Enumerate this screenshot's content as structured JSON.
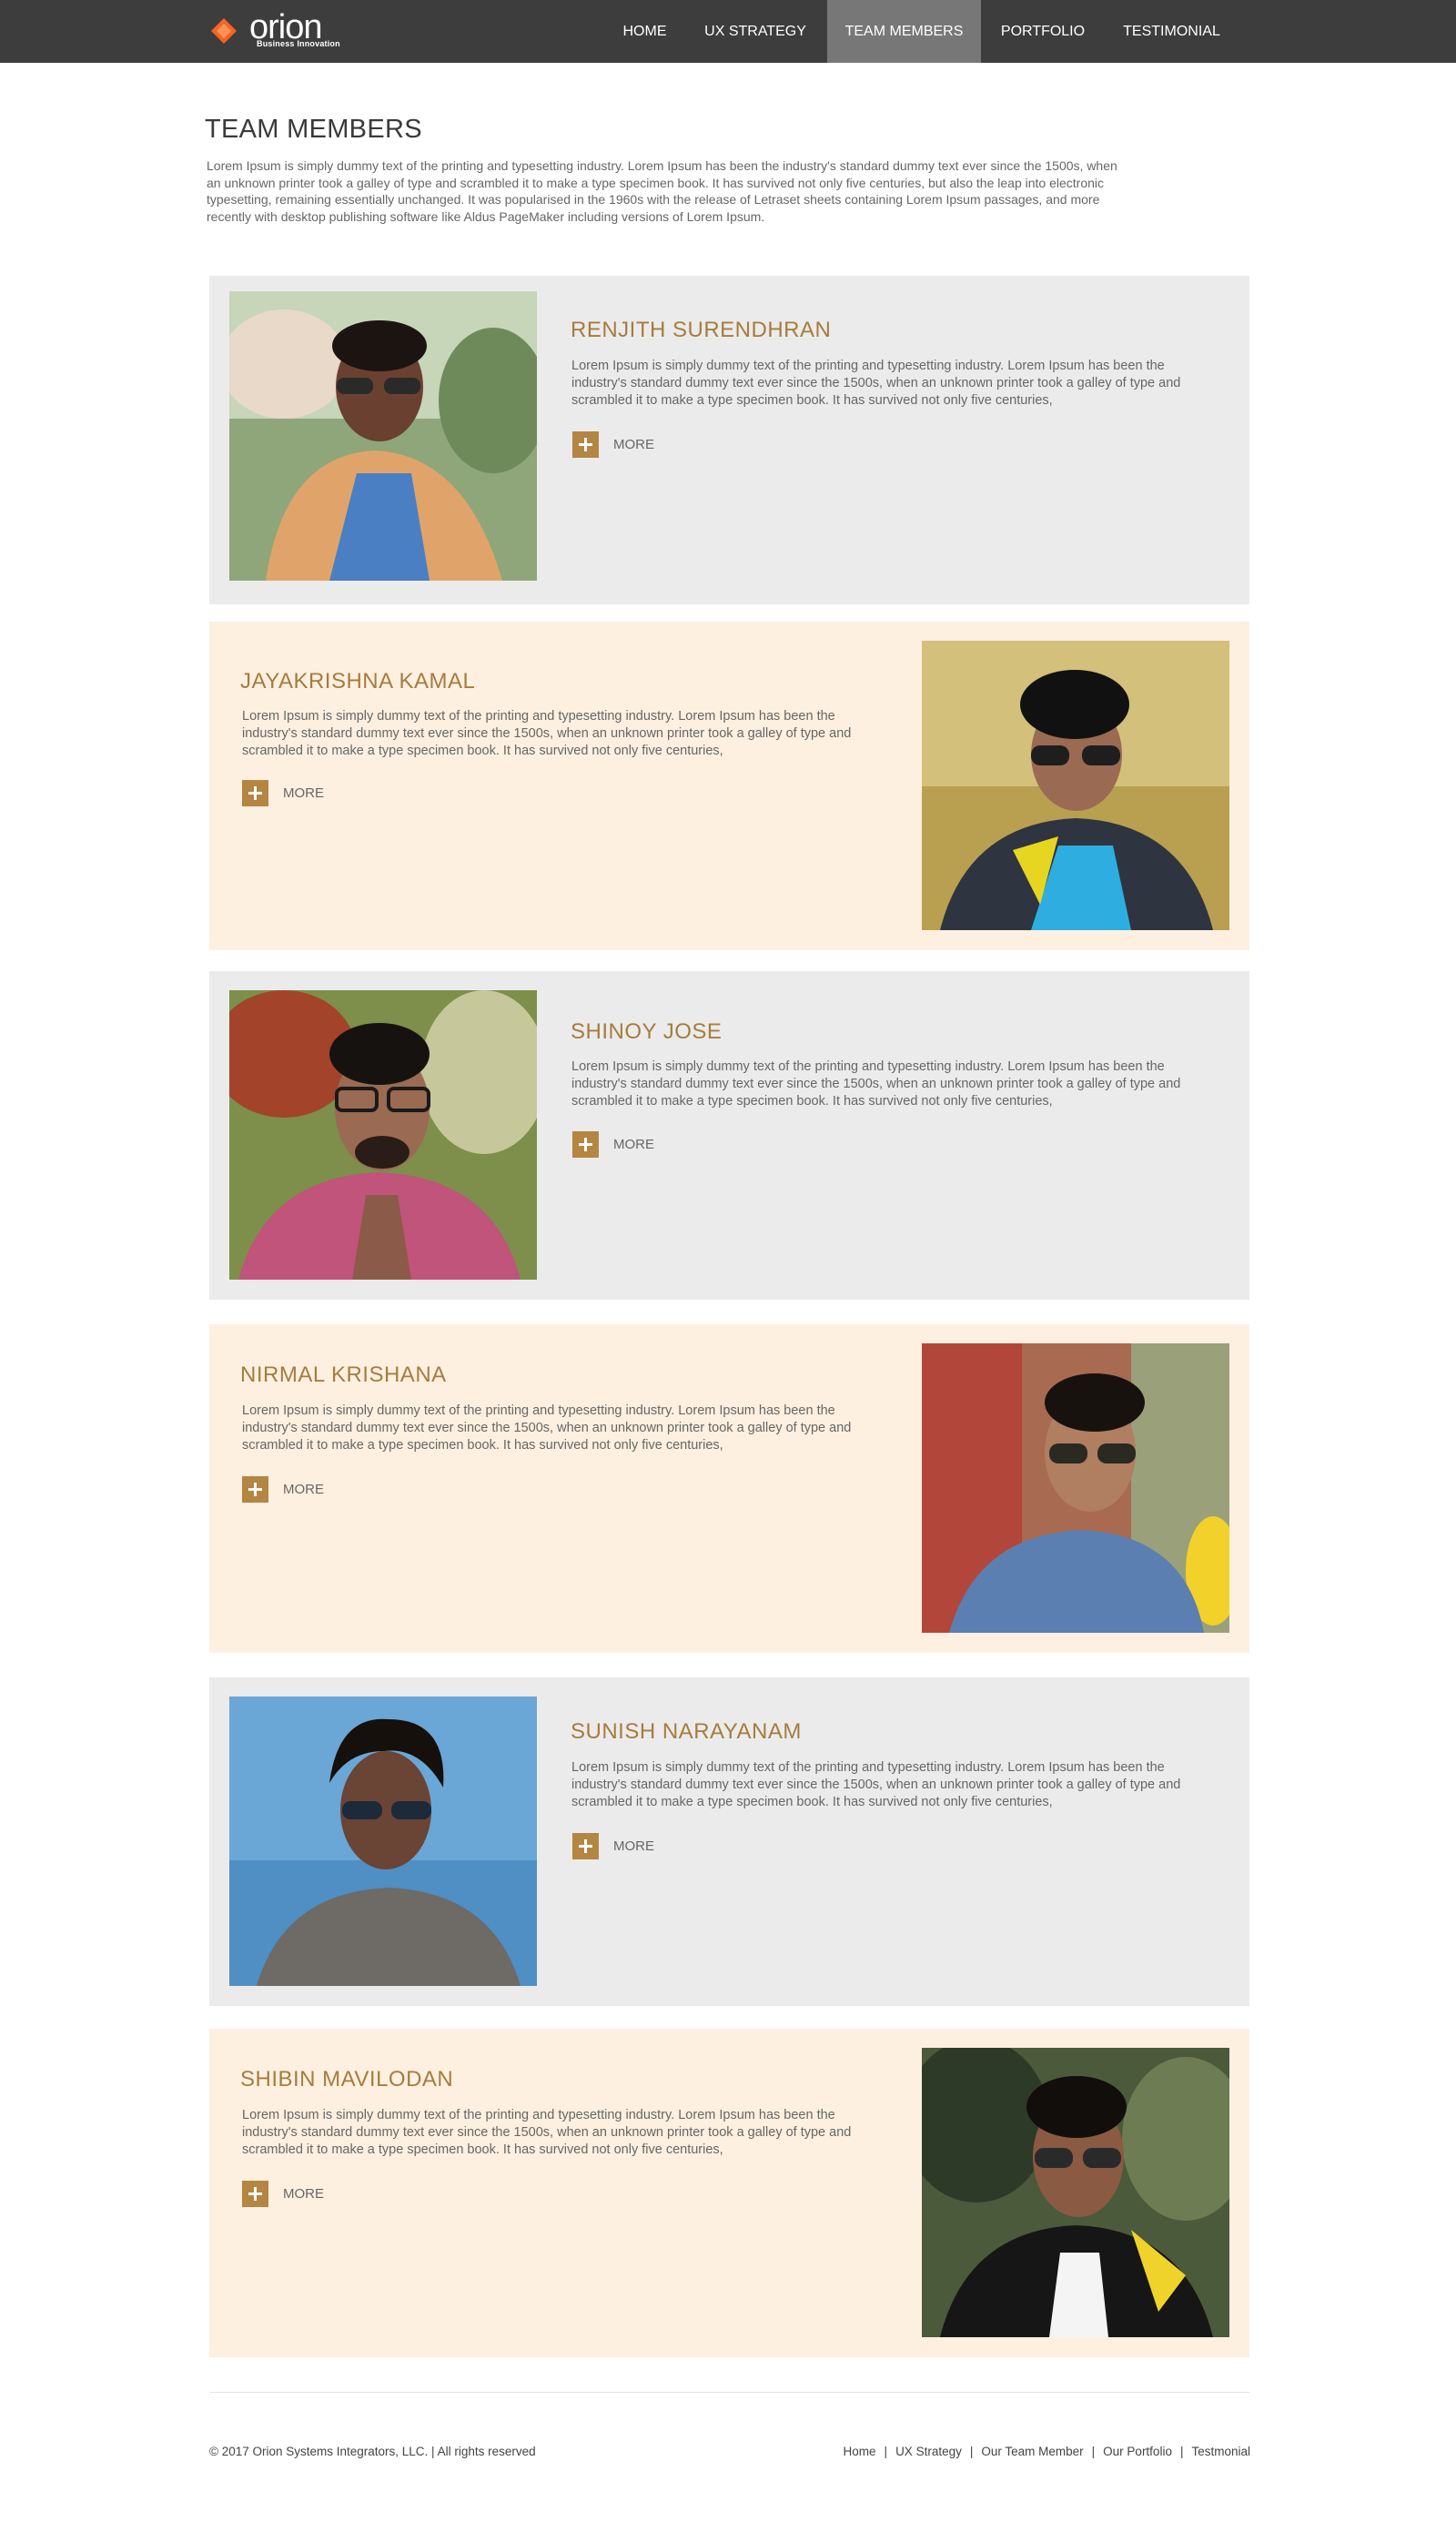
{
  "brand": {
    "name": "orion",
    "tagline": "Business Innovation",
    "accent": "#f26522"
  },
  "nav": {
    "items": [
      {
        "label": "HOME"
      },
      {
        "label": "UX STRATEGY"
      },
      {
        "label": "TEAM MEMBERS",
        "active": true
      },
      {
        "label": "PORTFOLIO"
      },
      {
        "label": "TESTIMONIAL"
      }
    ]
  },
  "page": {
    "title": "TEAM MEMBERS",
    "intro": "Lorem Ipsum is simply dummy text of the printing and typesetting industry. Lorem Ipsum has been the industry's standard dummy text ever since the 1500s, when an unknown printer took a galley of type and scrambled it to make a type specimen book. It has survived not only five centuries, but also the leap into electronic typesetting, remaining essentially unchanged. It was popularised in the 1960s with the release of Letraset sheets containing Lorem Ipsum passages, and more recently with desktop publishing software like Aldus PageMaker including versions of Lorem Ipsum."
  },
  "members": [
    {
      "name": "RENJITH SURENDHRAN",
      "desc": "Lorem Ipsum is simply dummy text of the printing and typesetting industry. Lorem Ipsum has been the industry's standard dummy text ever since the 1500s, when an unknown printer took a galley of type and scrambled it to make a type specimen book. It has survived not only five centuries,",
      "more": "MORE"
    },
    {
      "name": "JAYAKRISHNA KAMAL",
      "desc": "Lorem Ipsum is simply dummy text of the printing and typesetting industry. Lorem Ipsum has been the industry's standard dummy text ever since the 1500s, when an unknown printer took a galley of type and scrambled it to make a type specimen book. It has survived not only five centuries,",
      "more": "MORE"
    },
    {
      "name": "SHINOY JOSE",
      "desc": "Lorem Ipsum is simply dummy text of the printing and typesetting industry. Lorem Ipsum has been the industry's standard dummy text ever since the 1500s, when an unknown printer took a galley of type and scrambled it to make a type specimen book. It has survived not only five centuries,",
      "more": "MORE"
    },
    {
      "name": "NIRMAL KRISHANA",
      "desc": "Lorem Ipsum is simply dummy text of the printing and typesetting industry. Lorem Ipsum has been the industry's standard dummy text ever since the 1500s, when an unknown printer took a galley of type and scrambled it to make a type specimen book. It has survived not only five centuries,",
      "more": "MORE"
    },
    {
      "name": "SUNISH NARAYANAM",
      "desc": "Lorem Ipsum is simply dummy text of the printing and typesetting industry. Lorem Ipsum has been the industry's standard dummy text ever since the 1500s, when an unknown printer took a galley of type and scrambled it to make a type specimen book. It has survived not only five centuries,",
      "more": "MORE"
    },
    {
      "name": "SHIBIN MAVILODAN",
      "desc": "Lorem Ipsum is simply dummy text of the printing and typesetting industry. Lorem Ipsum has been the industry's standard dummy text ever since the 1500s, when an unknown printer took a galley of type and scrambled it to make a type specimen book. It has survived not only five centuries,",
      "more": "MORE"
    }
  ],
  "footer": {
    "copyright": "© 2017 Orion Systems Integrators, LLC. | All rights reserved",
    "links": [
      {
        "label": "Home"
      },
      {
        "label": "UX Strategy"
      },
      {
        "label": "Our Team Member"
      },
      {
        "label": "Our Portfolio"
      },
      {
        "label": "Testmonial"
      }
    ]
  }
}
